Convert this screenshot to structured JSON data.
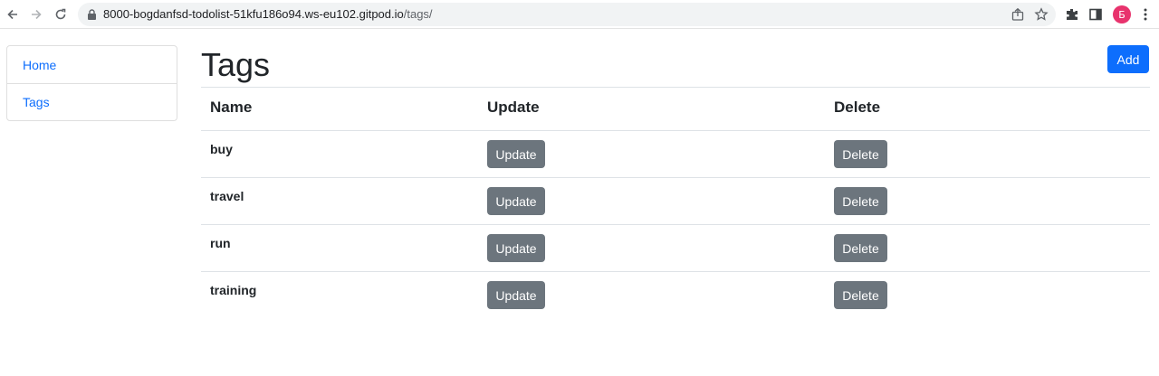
{
  "browser": {
    "url_host": "8000-bogdanfsd-todolist-51kfu186o94.ws-eu102.gitpod.io",
    "url_path": "/tags/",
    "avatar_letter": "Б",
    "icons": [
      "back-icon",
      "forward-icon",
      "reload-icon",
      "lock-icon",
      "share-icon",
      "star-icon",
      "extensions-icon",
      "side-panel-icon",
      "more-icon"
    ]
  },
  "sidebar": {
    "items": [
      {
        "label": "Home"
      },
      {
        "label": "Tags"
      }
    ]
  },
  "main": {
    "title": "Tags",
    "add_label": "Add",
    "columns": [
      "Name",
      "Update",
      "Delete"
    ],
    "rows": [
      {
        "name": "buy",
        "update_label": "Update",
        "delete_label": "Delete"
      },
      {
        "name": "travel",
        "update_label": "Update",
        "delete_label": "Delete"
      },
      {
        "name": "run",
        "update_label": "Update",
        "delete_label": "Delete"
      },
      {
        "name": "training",
        "update_label": "Update",
        "delete_label": "Delete"
      }
    ]
  },
  "colors": {
    "primary": "#0d6efd",
    "secondary": "#6c757d",
    "avatar": "#e8336d"
  }
}
